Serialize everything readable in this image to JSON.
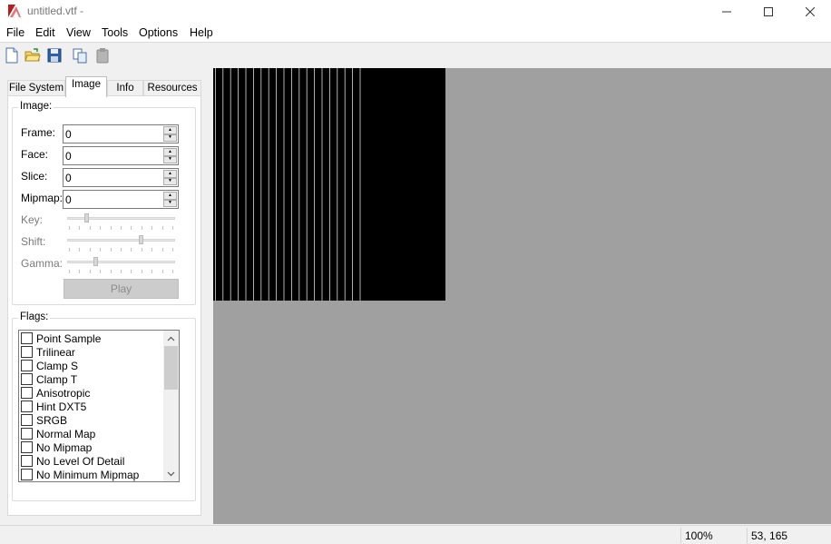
{
  "window": {
    "title": "untitled.vtf -"
  },
  "menu": [
    "File",
    "Edit",
    "View",
    "Tools",
    "Options",
    "Help"
  ],
  "toolbar": {
    "icons": [
      "new-file-icon",
      "open-folder-icon",
      "save-disk-icon",
      "copy-icon",
      "paste-icon"
    ]
  },
  "tabs": [
    "File System",
    "Image",
    "Info",
    "Resources"
  ],
  "active_tab": "Image",
  "image_group": {
    "label": "Image:",
    "frame": {
      "label": "Frame:",
      "value": "0"
    },
    "face": {
      "label": "Face:",
      "value": "0"
    },
    "slice": {
      "label": "Slice:",
      "value": "0"
    },
    "mipmap": {
      "label": "Mipmap:",
      "value": "0"
    },
    "key": {
      "label": "Key:",
      "level": 0.17
    },
    "shift": {
      "label": "Shift:",
      "level": 0.69
    },
    "gamma": {
      "label": "Gamma:",
      "level": 0.25
    },
    "play": "Play"
  },
  "flags_group": {
    "label": "Flags:",
    "items": [
      "Point Sample",
      "Trilinear",
      "Clamp S",
      "Clamp T",
      "Anisotropic",
      "Hint DXT5",
      "SRGB",
      "Normal Map",
      "No Mipmap",
      "No Level Of Detail",
      "No Minimum Mipmap"
    ]
  },
  "status": {
    "zoom": "100%",
    "coords": "53, 165"
  },
  "colors": {
    "viewport_bg": "#a0a0a0",
    "image_bg": "#000000",
    "image_stripes": "#ffffff"
  }
}
